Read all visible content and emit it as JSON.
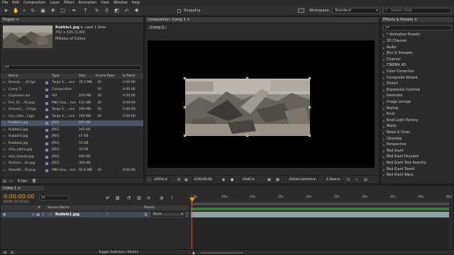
{
  "menu": [
    "File",
    "Edit",
    "Composition",
    "Layer",
    "Effect",
    "Animation",
    "View",
    "Window",
    "Help"
  ],
  "toolbar": {
    "snapping_label": "Snapping",
    "workspace_label": "Workspace:",
    "workspace_value": "Standard",
    "search_placeholder": "Search Help"
  },
  "project": {
    "tab_label": "Project ×",
    "preview": {
      "name": "Rubble1.jpg ▾",
      "used": ", used 1 time",
      "dims": "702 x 315 (1.00)",
      "colors": "Millions of Colors"
    },
    "search_placeholder": "ρ▾",
    "columns": {
      "name": "Name",
      "type": "Type",
      "size": "Size",
      "frame_rate": "Frame Rate",
      "in_point": "In Point"
    },
    "items": [
      {
        "name": "Beauty......0].tga",
        "type": "Targa S.....nce",
        "size": "35.5 MB",
        "fps": "30",
        "in": "0:00:00",
        "color": "#8a7fb8"
      },
      {
        "name": "Comp 1",
        "type": "Composition",
        "size": "",
        "fps": "30",
        "in": "0:00:00",
        "color": "#8a7fb8"
      },
      {
        "name": "Explosion.avi",
        "type": "AVI",
        "size": "259 MB",
        "fps": "30",
        "in": "0:00:00",
        "color": "#8a7fb8"
      },
      {
        "name": "Fire_21....9].png",
        "type": "PNG Seq....nce",
        "size": "131 MB",
        "fps": "30",
        "in": "0:00:00",
        "color": "#8a7fb8"
      },
      {
        "name": "Ground_....3].tga",
        "type": "Targa S.....nce",
        "size": "246 MB",
        "fps": "30",
        "in": "0:00:00",
        "color": "#8a7fb8"
      },
      {
        "name": "Gun_Hea...].tga",
        "type": "Targa S.....nce",
        "size": "246 MB",
        "fps": "30",
        "in": "0:00:00",
        "color": "#8a7fb8"
      },
      {
        "name": "Rubble1.jpg",
        "type": "JPEG",
        "size": "207 KB",
        "fps": "",
        "in": "",
        "color": "#8a7fb8"
      },
      {
        "name": "Rubble2.jpg",
        "type": "JPEG",
        "size": "245 KB",
        "fps": "",
        "in": "",
        "color": "#8a7fb8"
      },
      {
        "name": "Rubble3.jpg",
        "type": "JPEG",
        "size": "47 KB",
        "fps": "",
        "in": "",
        "color": "#8a7fb8"
      },
      {
        "name": "Rubble4.jpg",
        "type": "JPEG",
        "size": "55 KB",
        "fps": "",
        "in": "",
        "color": "#8a7fb8"
      },
      {
        "name": "ship_alpha.jpg",
        "type": "JPEG",
        "size": "33 KB",
        "fps": "",
        "in": "",
        "color": "#8a7fb8"
      },
      {
        "name": "ship_beauty.jpg",
        "type": "JPEG",
        "size": "640 KB",
        "fps": "",
        "in": "",
        "color": "#8a7fb8"
      },
      {
        "name": "Sinkhol....ter.jpg",
        "type": "JPEG",
        "size": "300 KB",
        "fps": "",
        "in": "",
        "color": "#8a7fb8"
      },
      {
        "name": "StreetB....9].png",
        "type": "PNG Seq....nce",
        "size": "82.6 MB",
        "fps": "30",
        "in": "0:00:00",
        "color": "#8a7fb8"
      }
    ],
    "selected_index": 6,
    "bpc": "8 bpc"
  },
  "composition": {
    "tab_label": "Composition: Comp 1 ×",
    "sub_tab": "Comp 1",
    "zoom": "(50%)",
    "timecode": "0:00:00:00",
    "resolution": "(Half)",
    "camera": "Active Camera",
    "view": "1 View"
  },
  "effects": {
    "tab_label": "Effects & Presets ×",
    "search_placeholder": "ρ▾",
    "items": [
      "* Animation Presets",
      "3D Channel",
      "Audio",
      "Blur & Sharpen",
      "Channel",
      "CINEMA 4D",
      "Color Correction",
      "Composite Wizard",
      "Distort",
      "Expression Controls",
      "Generate",
      "Image Lounge",
      "Keying",
      "Knoll",
      "Knoll Light Factory",
      "Matte",
      "Noise & Grain",
      "Obsolete",
      "Perspective",
      "Red Giant",
      "Red Giant Psunami",
      "Red Giant Text Anarchy",
      "Red Giant ToonIt",
      "Red Giant Warp"
    ]
  },
  "timeline": {
    "tab_label": "Comp 1 ×",
    "timecode": "0:00:00:00",
    "timecode_sub": "00000 (30.00 fps)",
    "search_placeholder": "ρ▾",
    "headers": {
      "source_name": "Source Name",
      "parent": "Parent"
    },
    "layer": {
      "number": "1",
      "name": "Rubble1.jpg",
      "parent": "None"
    },
    "ruler": [
      "0s",
      "05s",
      "10s",
      "15s",
      "20s",
      "25s",
      "30s",
      "35s",
      "40s",
      "45s"
    ],
    "toggle_label": "Toggle Switches / Modes"
  },
  "colors": {
    "accent_orange": "#f3a01a",
    "timeline_bar": "#8fa1a5",
    "selection": "#4a5568"
  }
}
